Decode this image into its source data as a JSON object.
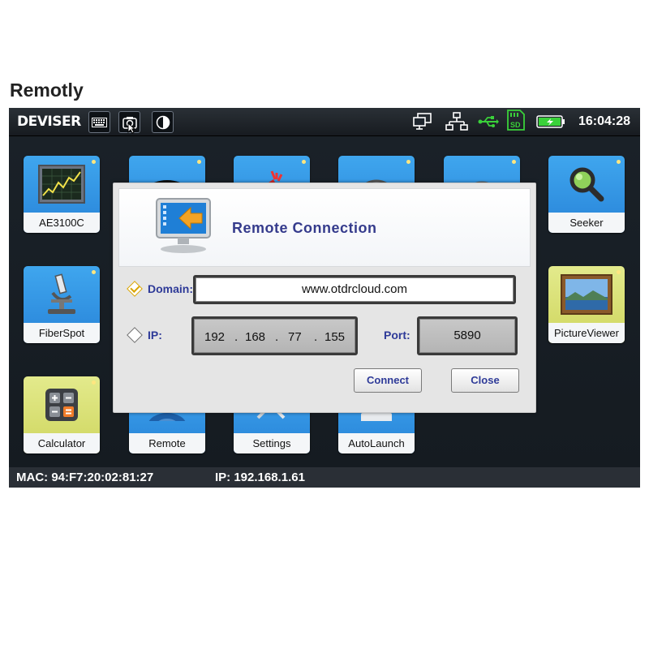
{
  "caption": "Remotly",
  "topbar": {
    "logo": "DEVISER",
    "clock": "16:04:28"
  },
  "apps": [
    {
      "label": "AE3100C",
      "icon": "spectrum-chart-icon"
    },
    {
      "label": "",
      "icon": "wifi-icon"
    },
    {
      "label": "",
      "icon": "laser-icon"
    },
    {
      "label": "",
      "icon": "meter-icon"
    },
    {
      "label": "",
      "icon": "power-meter-icon"
    },
    {
      "label": "Seeker",
      "icon": "magnifier-icon"
    },
    {
      "label": "FiberSpot",
      "icon": "microscope-icon"
    },
    {
      "label": "PictureViewer",
      "icon": "picture-icon"
    },
    {
      "label": "Calculator",
      "icon": "calculator-icon"
    },
    {
      "label": "Remote",
      "icon": "remote-icon"
    },
    {
      "label": "Settings",
      "icon": "settings-icon"
    },
    {
      "label": "AutoLaunch",
      "icon": "autolaunch-icon"
    }
  ],
  "statusbar": {
    "mac": "MAC: 94:F7:20:02:81:27",
    "ip": "IP: 192.168.1.61"
  },
  "dialog": {
    "title": "Remote Connection",
    "domain_label": "Domain:",
    "domain_value": "www.otdrcloud.com",
    "ip_label": "IP:",
    "ip_parts": [
      "192",
      "168",
      "77",
      "155"
    ],
    "port_label": "Port:",
    "port_value": "5890",
    "connect_label": "Connect",
    "close_label": "Close",
    "selected_mode": "Domain"
  },
  "colors": {
    "app_blue": "#2f8edf",
    "dialog_title": "#353b8c",
    "battery_green": "#3ad13a"
  }
}
